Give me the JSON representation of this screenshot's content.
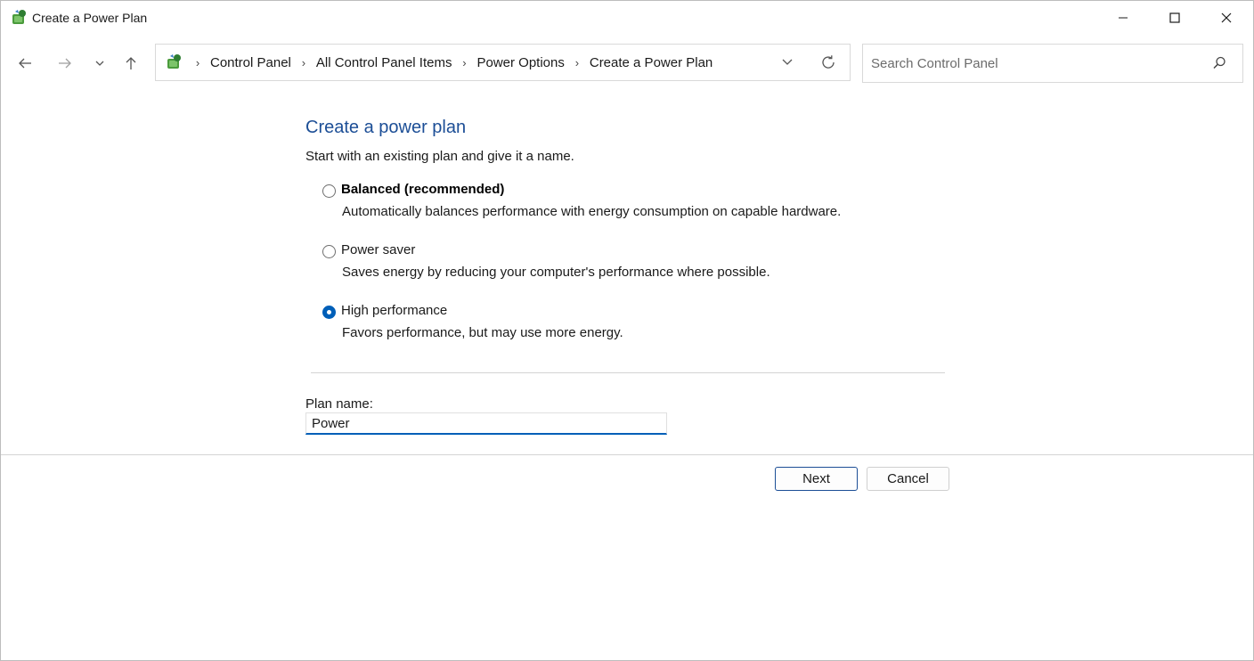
{
  "window": {
    "title": "Create a Power Plan"
  },
  "navigation": {
    "back_icon": "arrow-left-icon",
    "forward_icon": "arrow-right-icon",
    "recent_icon": "chevron-down-icon",
    "up_icon": "arrow-up-icon"
  },
  "address_bar": {
    "breadcrumbs": [
      "Control Panel",
      "All Control Panel Items",
      "Power Options",
      "Create a Power Plan"
    ]
  },
  "search": {
    "placeholder": "Search Control Panel"
  },
  "content": {
    "heading": "Create a power plan",
    "subtext": "Start with an existing plan and give it a name.",
    "options": [
      {
        "label": "Balanced (recommended)",
        "description": "Automatically balances performance with energy consumption on capable hardware.",
        "selected": false
      },
      {
        "label": "Power saver",
        "description": "Saves energy by reducing your computer's performance where possible.",
        "selected": false
      },
      {
        "label": "High performance",
        "description": "Favors performance, but may use more energy.",
        "selected": true
      }
    ],
    "plan_name_label": "Plan name:",
    "plan_name_value": "Power"
  },
  "buttons": {
    "next": "Next",
    "cancel": "Cancel"
  },
  "colors": {
    "heading": "#1c4e96",
    "accent": "#005fb8"
  }
}
